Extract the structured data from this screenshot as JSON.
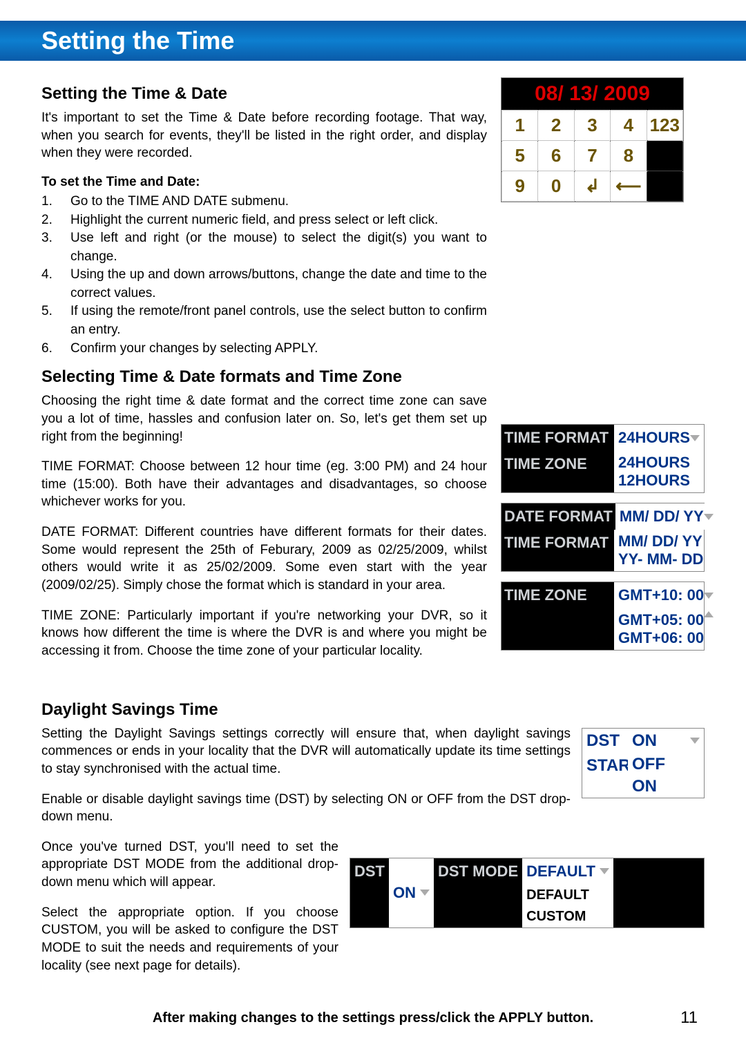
{
  "banner": {
    "title": "Setting the Time"
  },
  "section1": {
    "heading": "Setting the Time & Date",
    "intro": "It's important to set the Time & Date before recording footage. That way, when you search for events, they'll be listed in the right order, and display when they were recorded.",
    "subhead": "To set the Time and Date:",
    "steps": [
      "Go to the TIME AND DATE submenu.",
      "Highlight the current numeric field, and press select or left click.",
      "Use left and right (or the mouse) to select the digit(s) you want to change.",
      "Using the up and down arrows/buttons, change the date and time to the correct values.",
      "If using the remote/front panel controls, use the select button to confirm an entry.",
      "Confirm your changes by selecting APPLY."
    ]
  },
  "keypad": {
    "date": "08/ 13/ 2009",
    "btn_enter": "↲",
    "btn_back": "⟵",
    "multi": "123"
  },
  "section2": {
    "heading": "Selecting Time & Date formats and Time Zone",
    "p1": "Choosing the right time & date format and the correct time zone can save you a lot of time, hassles and confusion later on. So, let's get them set up right from the beginning!",
    "p2": "TIME FORMAT: Choose between 12 hour time (eg. 3:00 PM) and 24 hour time (15:00). Both have their advantages and disadvantages, so choose whichever works for you.",
    "p3": "DATE FORMAT: Different countries have different formats for their dates. Some would represent the 25th of Feburary, 2009 as 02/25/2009, whilst others would write it as 25/02/2009. Some even start with the year (2009/02/25). Simply chose the format which is standard in your area.",
    "p4": "TIME ZONE: Particularly important if you're networking your DVR, so it knows how different the time is where the DVR is and where you might be accessing it from. Choose the time zone of your particular locality."
  },
  "fig_timeformat": {
    "label1": "TIME  FORMAT",
    "val1": "24HOURS",
    "label2": "TIME    ZONE",
    "opt1": "24HOURS",
    "opt2": "12HOURS"
  },
  "fig_dateformat": {
    "label1": "DATE  FORMAT",
    "val1": "MM/ DD/ YY",
    "label2": "TIME  FORMAT",
    "opt1": "MM/ DD/ YY",
    "opt2": "YY- MM- DD"
  },
  "fig_timezone": {
    "label1": "TIME    ZONE",
    "val1": "GMT+10: 00",
    "opt1": "GMT+05: 00",
    "opt2": "GMT+06: 00"
  },
  "section3": {
    "heading": "Daylight Savings Time",
    "p1": "Setting the Daylight Savings settings correctly will ensure that, when daylight savings commences or ends in your locality that the DVR will automatically update its time settings to stay synchronised with the actual time.",
    "p2": "Enable or disable daylight savings time (DST) by selecting ON or OFF from the DST drop-down menu.",
    "p3": "Once you've turned DST, you'll need to set the appropriate DST MODE from the additional drop-down menu which will appear.",
    "p4": "Select the appropriate option. If you choose CUSTOM, you will be asked to configure the DST MODE to suit the needs and requirements of your locality (see next page for details)."
  },
  "fig_dst1": {
    "lbl1": "DST",
    "val1": "ON",
    "lbl2": "STAR",
    "opt1": "OFF",
    "opt2": "ON"
  },
  "fig_dst2": {
    "c1": "DST",
    "c2": "ON",
    "c3": "DST  MODE",
    "c4": "DEFAULT",
    "opt1": "DEFAULT",
    "opt2": "CUSTOM"
  },
  "footer": "After making changes to the settings press/click the APPLY button.",
  "pagenum": "11"
}
